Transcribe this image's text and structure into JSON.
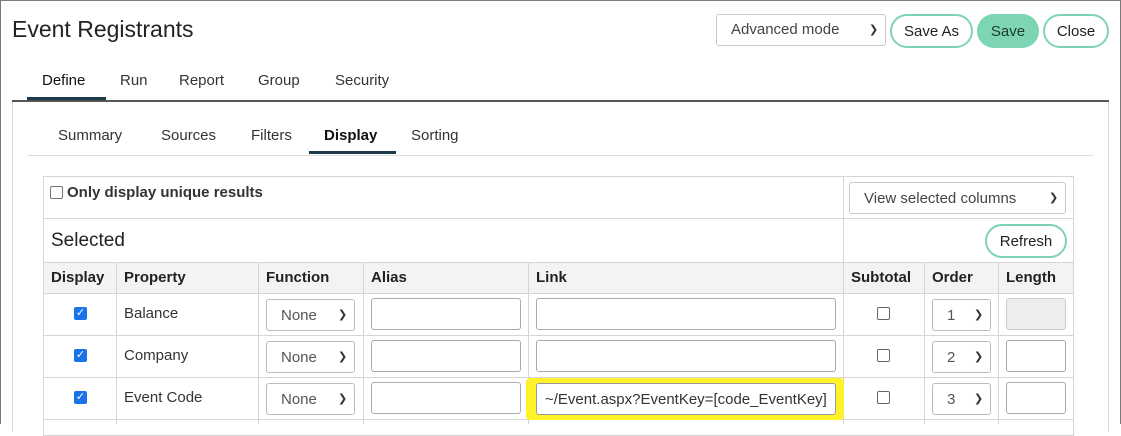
{
  "header": {
    "title": "Event Registrants",
    "mode": "Advanced mode",
    "save_as_label": "Save As",
    "save_label": "Save",
    "close_label": "Close"
  },
  "main_tabs": [
    "Define",
    "Run",
    "Report",
    "Group",
    "Security"
  ],
  "sub_tabs": [
    "Summary",
    "Sources",
    "Filters",
    "Display",
    "Sorting"
  ],
  "display": {
    "unique_label": "Only display unique results",
    "view_select": "View selected columns",
    "selected_label": "Selected",
    "refresh_label": "Refresh",
    "columns": [
      "Display",
      "Property",
      "Function",
      "Alias",
      "Link",
      "Subtotal",
      "Order",
      "Length"
    ],
    "rows": [
      {
        "display": true,
        "property": "Balance",
        "function": "None",
        "alias": "",
        "link": "",
        "subtotal": false,
        "order": "1",
        "length": ""
      },
      {
        "display": true,
        "property": "Company",
        "function": "None",
        "alias": "",
        "link": "",
        "subtotal": false,
        "order": "2",
        "length": ""
      },
      {
        "display": true,
        "property": "Event Code",
        "function": "None",
        "alias": "",
        "link": "~/Event.aspx?EventKey=[code_EventKey]",
        "subtotal": false,
        "order": "3",
        "length": ""
      }
    ]
  },
  "colors": {
    "accent_green": "#7dd5b3",
    "tab_underline": "#1c3b4a",
    "highlight": "#fff12a",
    "checkbox_blue": "#1a73e8"
  }
}
